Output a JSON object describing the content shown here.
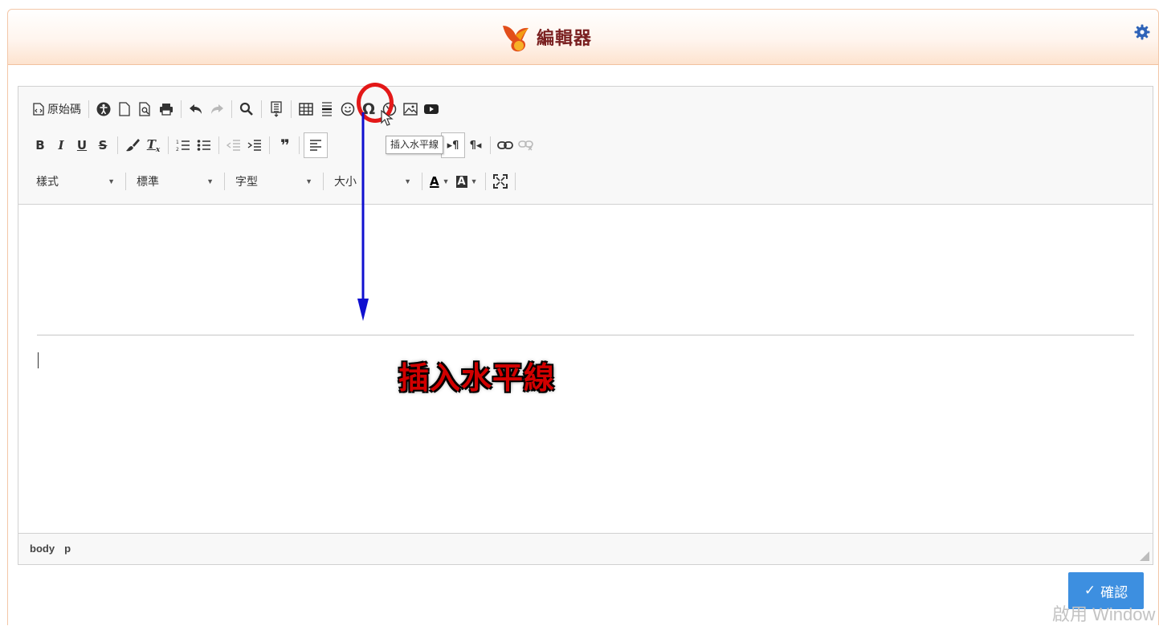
{
  "dialog": {
    "title": "編輯器"
  },
  "toolbar": {
    "source_label": "原始碼",
    "style_combo": "樣式",
    "format_combo": "標準",
    "font_combo": "字型",
    "size_combo": "大小",
    "text_color_label": "A",
    "bg_color_label": "A"
  },
  "tooltip": {
    "text": "插入水平線"
  },
  "statusbar": {
    "path": [
      "body",
      "p"
    ]
  },
  "annotation": {
    "text": "插入水平線"
  },
  "footer": {
    "confirm_label": "確認"
  },
  "watermark": {
    "text": "啟用 Window"
  },
  "colors": {
    "accent": "#3d8fe0",
    "highlight": "#e31818",
    "arrow": "#1010d0",
    "annotation": "#d10000"
  }
}
